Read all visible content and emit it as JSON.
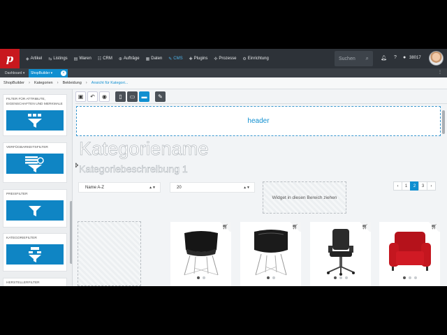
{
  "nav": {
    "items": [
      {
        "label": "Artikel",
        "icon": "tag-icon"
      },
      {
        "label": "Listings",
        "icon": "listings-icon"
      },
      {
        "label": "Waren",
        "icon": "goods-icon"
      },
      {
        "label": "CRM",
        "icon": "crm-icon"
      },
      {
        "label": "Aufträge",
        "icon": "cart-icon"
      },
      {
        "label": "Daten",
        "icon": "data-icon"
      },
      {
        "label": "CMS",
        "icon": "cms-icon",
        "active": true
      },
      {
        "label": "Plugins",
        "icon": "plugins-icon"
      },
      {
        "label": "Prozesse",
        "icon": "process-icon"
      },
      {
        "label": "Einrichtung",
        "icon": "settings-icon"
      }
    ],
    "search_placeholder": "Suchen",
    "user_id": "38017",
    "accent": "#108fd0"
  },
  "tabs": {
    "dashboard": "Dashboard ▾",
    "shopbuilder": "ShopBuilder ▾"
  },
  "breadcrumb": {
    "items": [
      "ShopBuilder",
      "Kategorien",
      "Bekleidung"
    ],
    "active": "Ansicht für Kategori..."
  },
  "sidebar": {
    "cards": [
      {
        "label": "FILTER FÜR ATTRIBUTE, EIGENSCHAFTEN UND MERKMALE"
      },
      {
        "label": "VERFÜGBARKEITSFILTER"
      },
      {
        "label": "PREISFILTER"
      },
      {
        "label": "KATEGORIEFILTER"
      },
      {
        "label": "HERSTELLERFILTER"
      }
    ]
  },
  "canvas": {
    "header_label": "header",
    "category_name": "Kategoriename",
    "category_description": "Kategoriebeschreibung 1",
    "sort_select": "Name A-Z",
    "per_page_select": "20",
    "widget_drop": "Widget in diesen Bereich ziehen",
    "pagination": {
      "prev": "‹",
      "pages": [
        "1",
        "2",
        "3"
      ],
      "current": "2",
      "next": "›"
    }
  },
  "products": [
    {
      "name": "black-chair-wire-base"
    },
    {
      "name": "black-chair-wire-base-2"
    },
    {
      "name": "office-chair"
    },
    {
      "name": "red-armchair"
    }
  ]
}
